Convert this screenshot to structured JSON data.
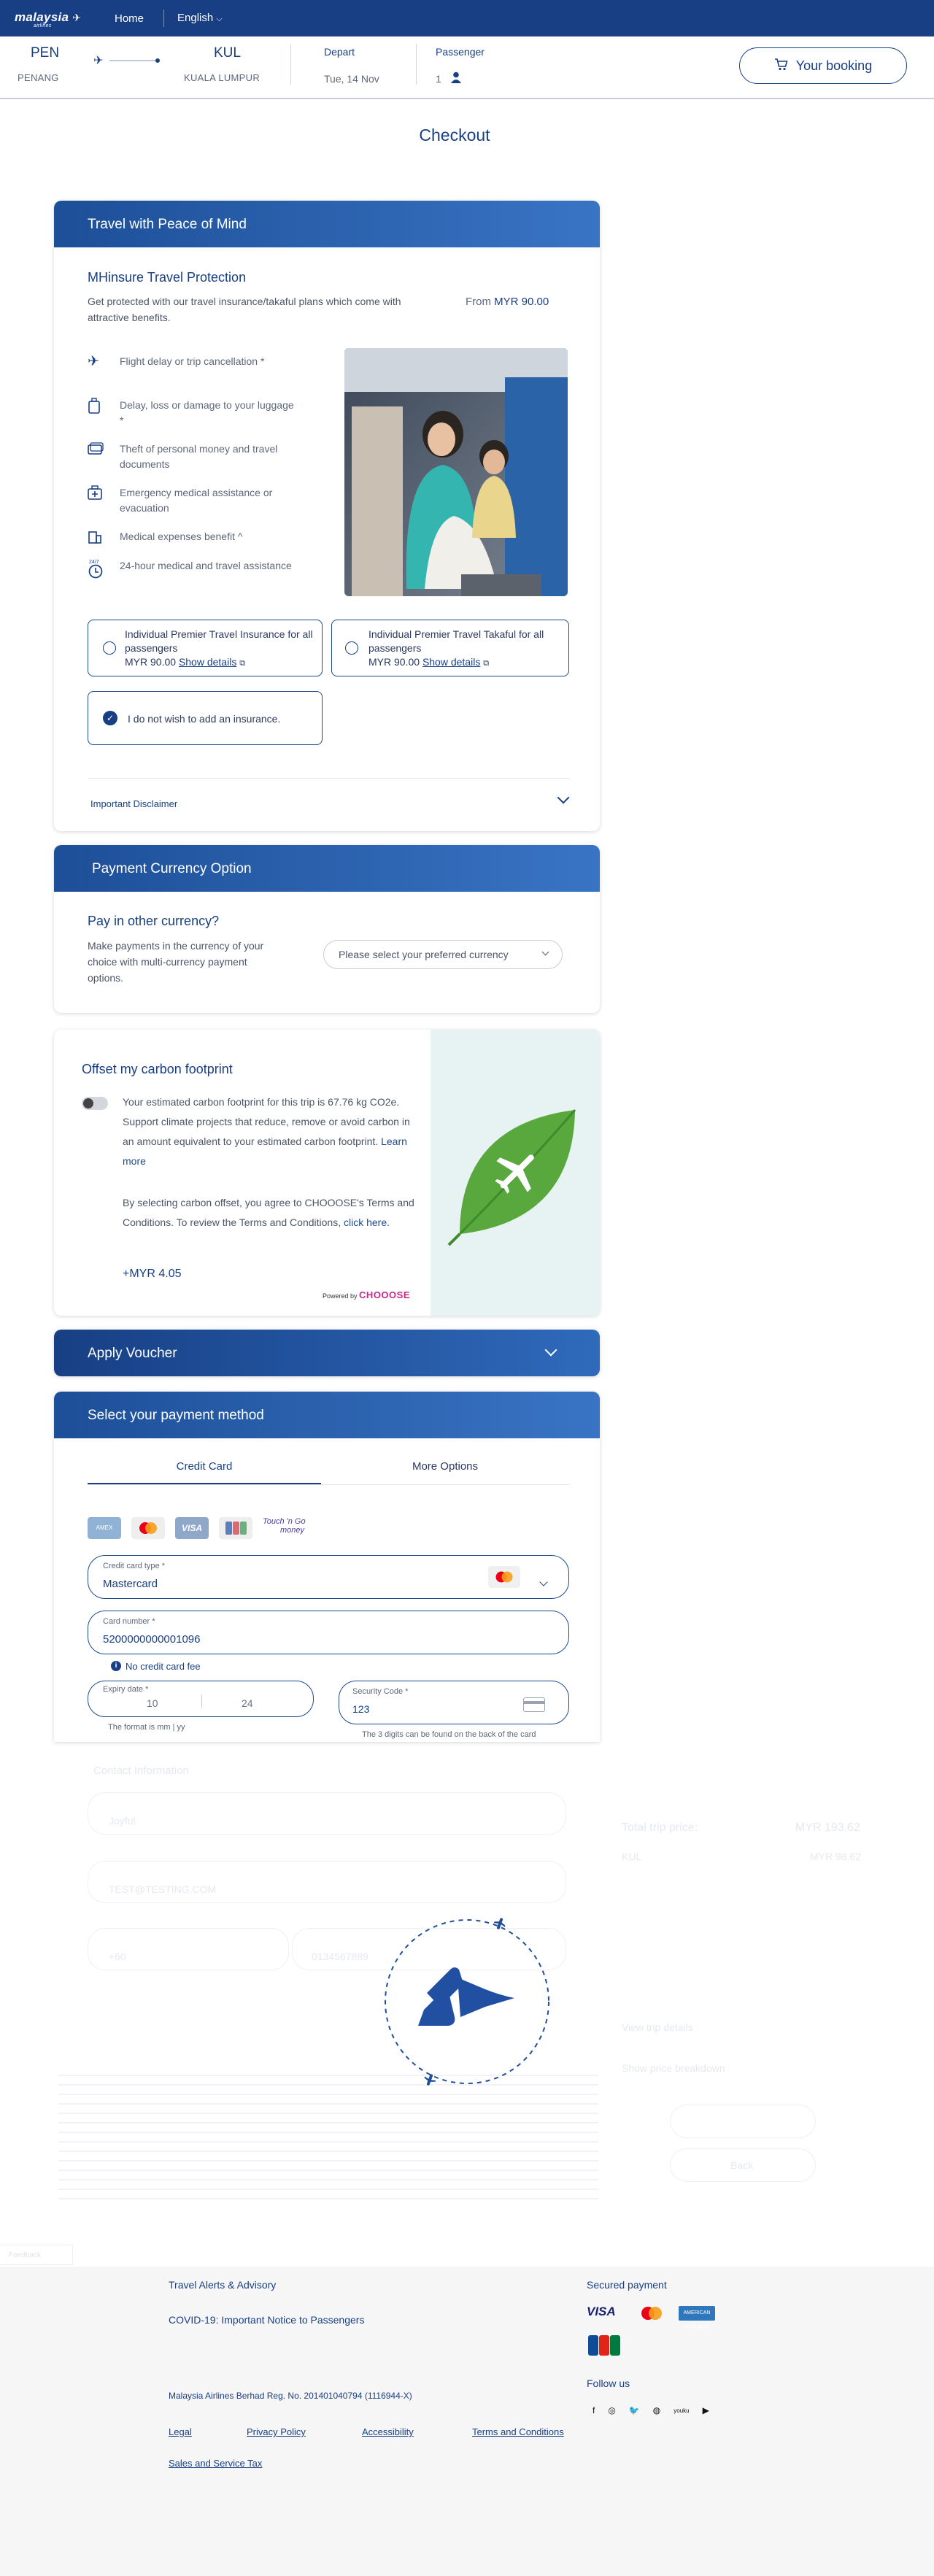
{
  "brand": {
    "logo": "malaysia",
    "logo_sub": "airlines"
  },
  "nav": {
    "home": "Home",
    "language": "English"
  },
  "trip": {
    "from_code": "PEN",
    "from_city": "PENANG",
    "to_code": "KUL",
    "to_city": "KUALA LUMPUR",
    "depart_label": "Depart",
    "depart_value": "Tue, 14 Nov",
    "passenger_label": "Passenger",
    "passenger_value": "1",
    "booking_button": "Your booking"
  },
  "page_title": "Checkout",
  "insurance": {
    "header": "Travel with Peace of Mind",
    "title": "MHinsure Travel Protection",
    "description": "Get protected with our travel insurance/takaful plans which come with attractive benefits.",
    "from_label": "From",
    "price": "MYR 90.00",
    "features": [
      {
        "icon": "flight-cancel-icon",
        "text": "Flight delay or trip cancellation *"
      },
      {
        "icon": "luggage-icon",
        "text": "Delay, loss or damage to your luggage *"
      },
      {
        "icon": "documents-icon",
        "text": "Theft of personal money and travel documents"
      },
      {
        "icon": "medical-bag-icon",
        "text": "Emergency medical assistance or evacuation"
      },
      {
        "icon": "hospital-icon",
        "text": "Medical expenses benefit ^"
      },
      {
        "icon": "clock-24-icon",
        "text": "24-hour medical and travel assistance"
      }
    ],
    "option1": {
      "title": "Individual Premier Travel Insurance for all passengers",
      "price": "MYR 90.00",
      "link": "Show details"
    },
    "option2": {
      "title": "Individual Premier Travel Takaful for all passengers",
      "price": "MYR 90.00",
      "link": "Show details"
    },
    "option3": "I do not wish to add an insurance.",
    "disclaimer": "Important Disclaimer"
  },
  "currency": {
    "header": "Payment Currency Option",
    "title": "Pay in other currency?",
    "description": "Make payments in the currency of your choice with multi-currency payment options.",
    "select_placeholder": "Please select your preferred currency"
  },
  "carbon": {
    "title": "Offset my carbon footprint",
    "text1": "Your estimated carbon footprint for this trip is 67.76 kg CO2e. Support climate projects that reduce, remove or avoid carbon in an amount equivalent to your estimated carbon footprint.",
    "learn_more": "Learn more",
    "text2": "By selecting carbon offset, you agree to CHOOOSE's Terms and Conditions. To review the Terms and Conditions,",
    "click_here": "click here.",
    "price": "+MYR 4.05",
    "powered": "Powered by",
    "powered_brand": "CHOOOSE"
  },
  "voucher": {
    "header": "Apply Voucher"
  },
  "payment": {
    "header": "Select your payment method",
    "tab_card": "Credit Card",
    "tab_more": "More Options",
    "card_type_label": "Credit card type *",
    "card_type_value": "Mastercard",
    "card_number_label": "Card number *",
    "card_number_value": "5200000000001096",
    "no_fee": "No credit card fee",
    "expiry_label": "Expiry date *",
    "expiry_month": "10",
    "expiry_year": "24",
    "expiry_hint": "The format is mm | yy",
    "security_label": "Security Code *",
    "security_value": "123",
    "security_hint": "The 3 digits can be found on the back of the card",
    "logos": [
      "AMEX",
      "MC",
      "VISA",
      "JCB",
      "Touch n Go"
    ]
  },
  "faded": {
    "contact": "Contact Information",
    "first": "Joyful",
    "email": "TEST@TESTING.COM",
    "country": "+60",
    "phone": "0134567889",
    "total_label": "Total trip price:",
    "total_value": "MYR 193.62",
    "route": "KUL",
    "route_price": "MYR 98.62",
    "view_details": "View trip details",
    "breakdown": "Show price breakdown",
    "submit": "Back",
    "feedback": "Feedback"
  },
  "footer": {
    "alerts": "Travel Alerts & Advisory",
    "covid": "COVID-19: Important Notice to Passengers",
    "secured": "Secured payment",
    "follow": "Follow us",
    "reg": "Malaysia Airlines Berhad Reg. No. 201401040794 (1116944-X)",
    "links": [
      "Legal",
      "Privacy Policy",
      "Accessibility",
      "Terms and Conditions",
      "Sales and Service Tax"
    ]
  }
}
